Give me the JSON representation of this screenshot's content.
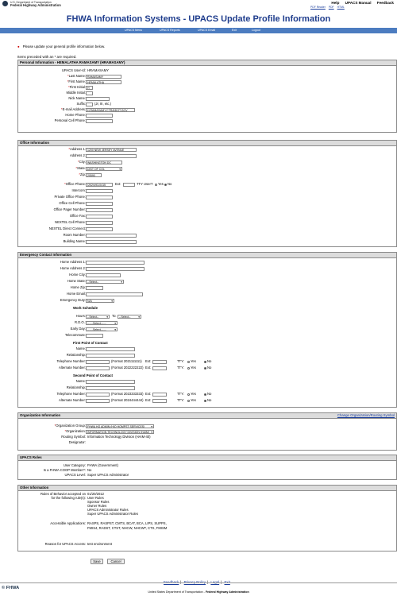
{
  "header": {
    "agency_line1": "U.S. Department of Transportation",
    "agency_line2": "Federal Highway Administration",
    "top_links": [
      "Help",
      "UPACS Manual",
      "Feedback"
    ],
    "sub_links": [
      "PDF Reader",
      "PDF",
      "HTML"
    ],
    "title": "FHWA Information Systems - UPACS Update Profile Information"
  },
  "nav": [
    "UPACS Menu",
    "UPACS Reports",
    "UPACS Email",
    "Exit",
    "Logout"
  ],
  "message": "Please update your general profile information below.",
  "required_note": "Items preceded with an * are required.",
  "personal": {
    "header": "Personal Information - HEMALATHA RAMASAMY (HRAMASAMY)",
    "user_id_label": "UPACS User-Id:",
    "user_id": "HRAMASAMY",
    "last_name_label": "Last Name:",
    "last_name": "RAMASAMY",
    "first_name_label": "First Name:",
    "first_name": "HEMALATHA",
    "first_initial_label": "First Initial:",
    "first_initial": "H",
    "middle_initial_label": "Middle Initial:",
    "nick_name_label": "Nick Name:",
    "suffix_label": "Suffix:",
    "suffix_hint": "(Jr, III, etc.)",
    "email_label": "E-mail Address:",
    "email": "H.RAMASAMY.CTR@DOT.GOV",
    "home_phone_label": "Home Phone:",
    "cell_phone_label": "Personal Cell Phone:"
  },
  "office": {
    "header": "Office Information",
    "address1_label": "Address 1:",
    "address1": "1200 NEW JERSEY AVENUE",
    "address2_label": "Address 2:",
    "city_label": "City:",
    "city": "WASHINGTON DC",
    "state_label": "State:",
    "state": "DIST OF COL",
    "zip_label": "Zip:",
    "zip": "20590",
    "office_phone_label": "Office Phone:",
    "office_phone": "(202)493-0415",
    "ext_label": "Ext:",
    "tty_label": "TTY User?:",
    "yes": "Yes",
    "no": "No",
    "intercom_label": "Intercom:",
    "private_phone_label": "Private Office Phone:",
    "office_cell_label": "Office Cell Phone:",
    "pager_label": "Office Pager Number:",
    "fax_label": "Office Fax:",
    "nextel_cell_label": "NEXTEL Cell Phone:",
    "nextel_direct_label": "NEXTEL Direct Connect:",
    "room_label": "Room Number:",
    "building_label": "Building Name:"
  },
  "emergency": {
    "header": "Emergency Contact Information",
    "home_addr1_label": "Home Address 1:",
    "home_addr2_label": "Home Address 2:",
    "home_city_label": "Home City:",
    "home_state_label": "Home State:",
    "home_state": "--Select--",
    "home_zip_label": "Home Zip:",
    "home_email_label": "Home Email:",
    "emergency_duty_label": "Emergency Duty:",
    "emergency_duty": "N/A",
    "work_schedule": "Work Schedule",
    "hours_label": "Hours:",
    "hours_from": "--Select--",
    "to_label": "To:",
    "hours_to": "--Select--",
    "rdo_label": "R.D.O.:",
    "rdo": "------Select------",
    "early_day_label": "Early Day:",
    "early_day": "------Select------",
    "telecommute_label": "Telecommute:",
    "first_poc": "First Point of Contact",
    "second_poc": "Second Point of Contact",
    "name_label": "Name:",
    "relationship_label": "Relationship:",
    "telephone_label": "Telephone Number:",
    "alternate_label": "Alternate Number:",
    "fmt1": "(Format 2021111111)",
    "fmt2": "(Format 2022222222)",
    "fmt3": "(Format 2023333333)",
    "fmt4": "(Format 2024444444)",
    "ext_label": "Ext:",
    "tty_label": "TTY:",
    "yes": "Yes",
    "no": "No"
  },
  "org": {
    "header": "Organization Information",
    "change_link": "Change Organization/Routing Symbol",
    "group_label": "Organization Group:",
    "group": "FHWA HQ ADMIN (HIO HQMPST SERVICES)",
    "org_label": "Organization:",
    "org_val": "INFORMATION TECHNOLOGY DIVISION (HAIM)",
    "routing_label": "Routing Symbol:",
    "routing": "Information Technology Division (HAIM-40)",
    "designator_label": "Designator:"
  },
  "roles": {
    "header": "UPACS Roles",
    "category_label": "User Category:",
    "category": "FHWA (Government)",
    "coop_label": "Is a FHWA COOP Member?:",
    "coop": "No",
    "level_label": "UPACS Level:",
    "level": "Super UPACS Administrator"
  },
  "other": {
    "header": "Other Information",
    "rules_label1": "Rules of Behavior accepted on",
    "rules_date": "01/20/2012",
    "rules_label2": "for the following rule(s):",
    "rules": [
      "User Rules",
      "Sponsor Rules",
      "Owner Rules",
      "UPACS Administrator Rules",
      "Super UPACS Administrator Rules"
    ],
    "apps_label": "Accessible Applications:",
    "apps_line1": "RASPS, RASPST, CMTS, BCAT, BCA, LIPS, SUPPS,",
    "apps_line2": "FMIS4, RADST, CTST, NHCW, NHCWT, CTS, FMISM",
    "reason_label": "Reason for UPACS Access:",
    "reason": "test environment"
  },
  "buttons": {
    "save": "Save",
    "cancel": "Cancel"
  },
  "footer": {
    "links": [
      "Feedback",
      "Privacy Policy",
      "Legal",
      "Exit"
    ],
    "brand": "FHWA",
    "dot_line_prefix": "United States Department of Transportation - ",
    "dot_line_bold": "Federal Highway Administration"
  },
  "colors": {
    "title": "#1e3c8c",
    "nav": "#4c7cc0",
    "required": "#cc0000",
    "link": "#1a3d9c"
  }
}
